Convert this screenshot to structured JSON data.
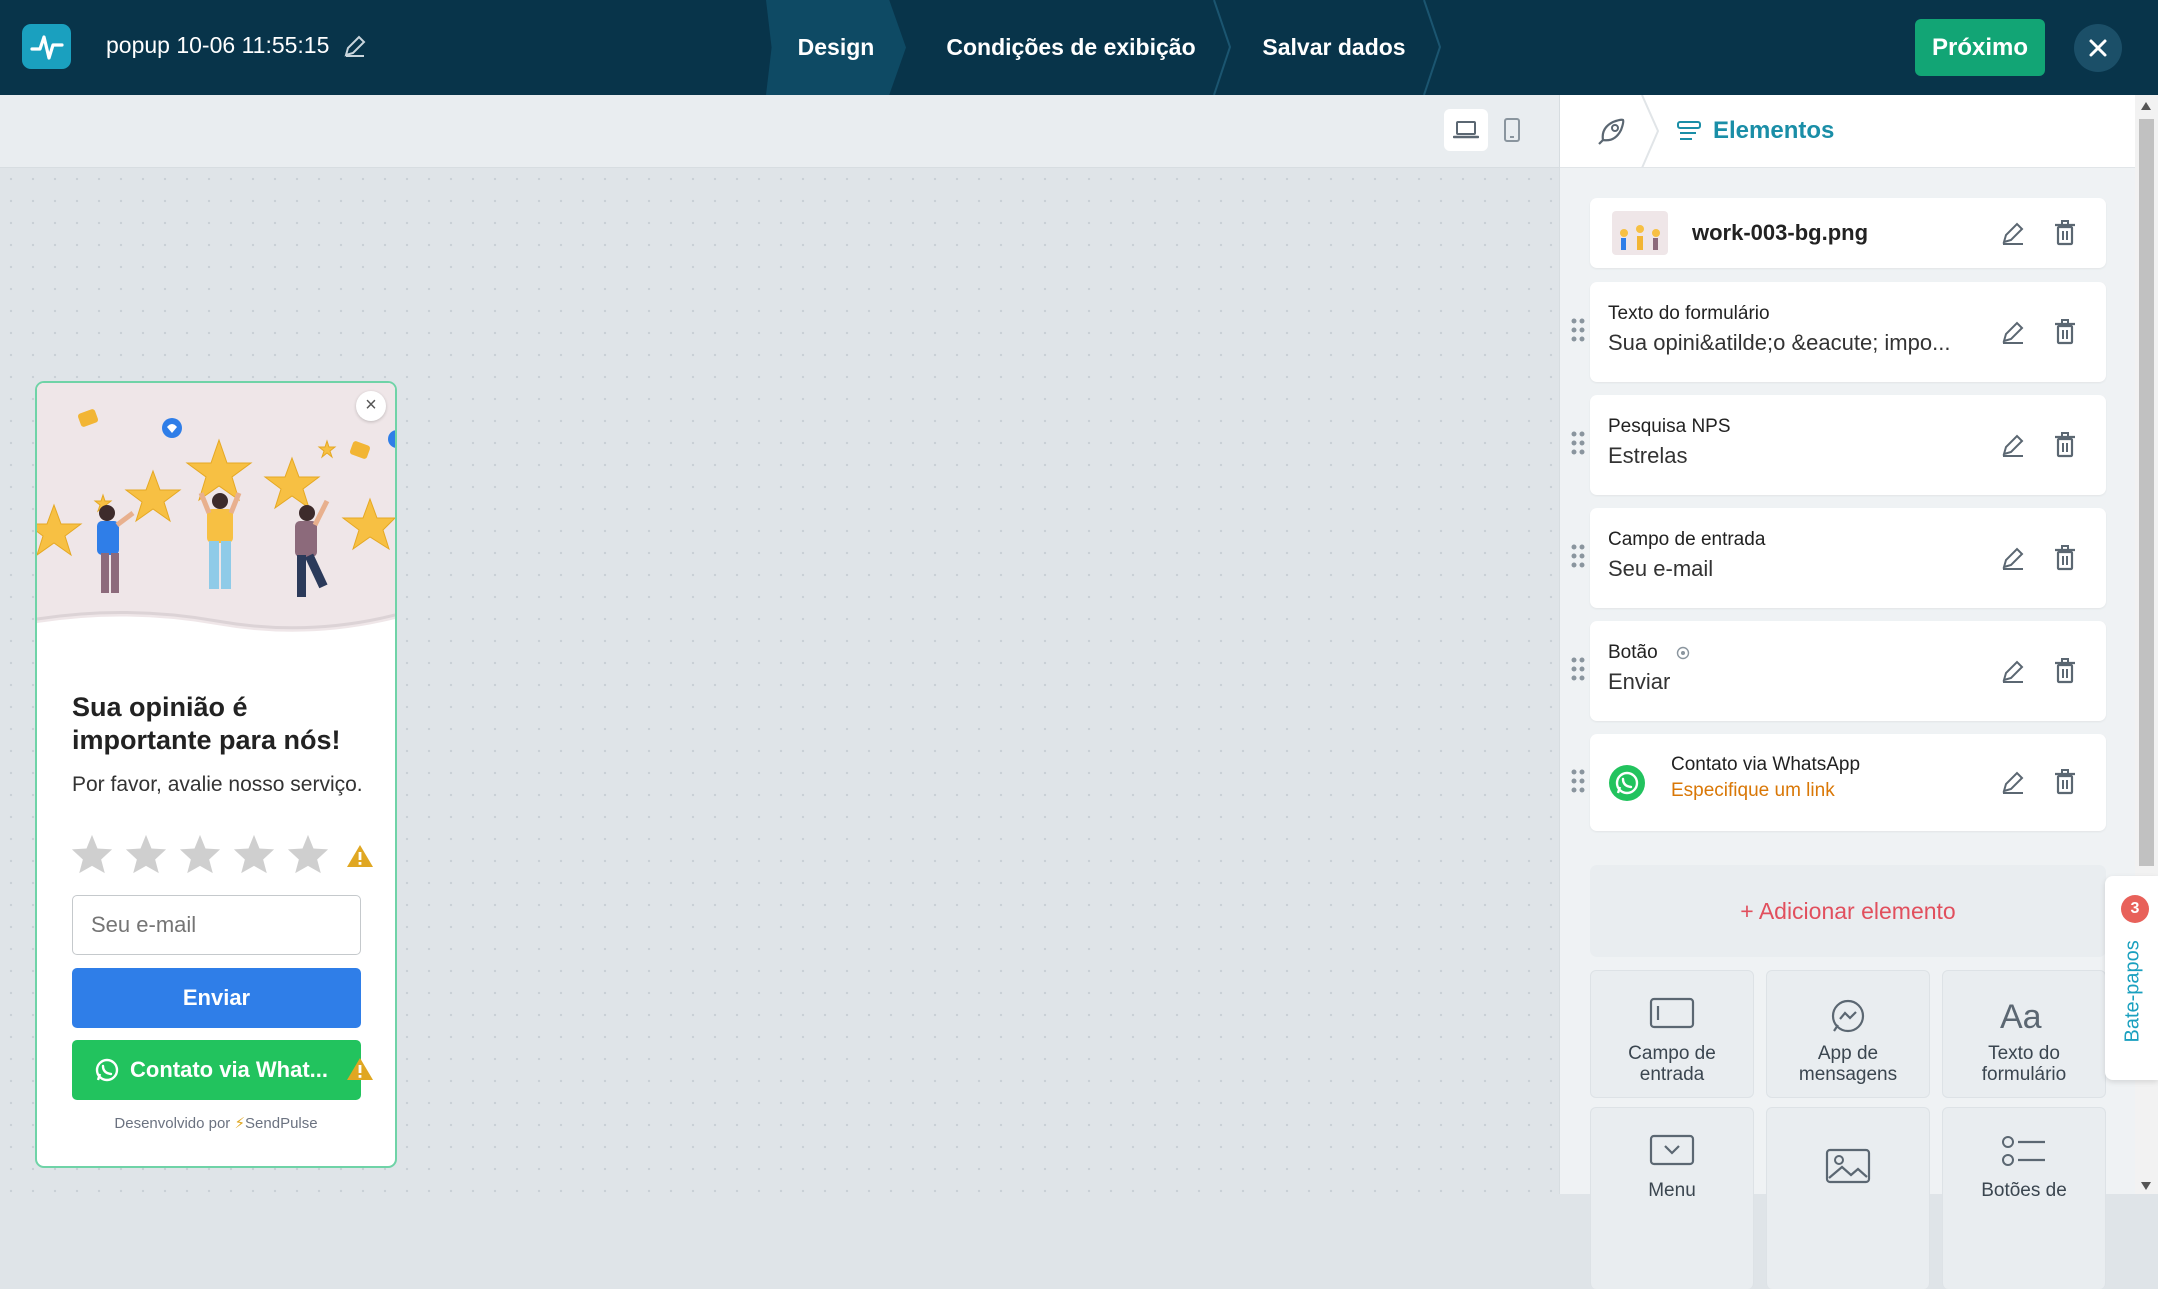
{
  "topbar": {
    "title": "popup 10-06 11:55:15",
    "steps": [
      "Design",
      "Condições de exibição",
      "Salvar dados"
    ],
    "next_label": "Próximo"
  },
  "popup": {
    "heading": "Sua opinião é importante para nós!",
    "subtitle": "Por favor, avalie nosso serviço.",
    "star_count": 5,
    "email_placeholder": "Seu e-mail",
    "send_label": "Enviar",
    "whatsapp_label": "Contato via What...",
    "powered_prefix": "Desenvolvido por",
    "powered_brand": "SendPulse"
  },
  "panel": {
    "title": "Elementos",
    "image_element": "work-003-bg.png",
    "elements": [
      {
        "label": "Texto do formulário",
        "value": "Sua opini&atilde;o &eacute; impo..."
      },
      {
        "label": "Pesquisa NPS",
        "value": "Estrelas"
      },
      {
        "label": "Campo de entrada",
        "value": "Seu e-mail"
      },
      {
        "label": "Botão",
        "value": "Enviar"
      }
    ],
    "whatsapp_element": {
      "label": "Contato via WhatsApp",
      "value": "Especifique um link"
    },
    "add_label": "+ Adicionar elemento",
    "tiles": [
      {
        "line1": "Campo de",
        "line2": "entrada"
      },
      {
        "line1": "App de",
        "line2": "mensagens"
      },
      {
        "line1": "Texto do",
        "line2": "formulário"
      },
      {
        "line1": "Menu",
        "line2": ""
      },
      {
        "line1": "",
        "line2": ""
      },
      {
        "line1": "Botões de",
        "line2": ""
      }
    ]
  },
  "chat": {
    "label": "Bate-papos",
    "count": "3"
  },
  "colors": {
    "topbar": "#08344a",
    "accent": "#1aa0bf",
    "next_button": "#12a575",
    "send_button": "#2f7ee8",
    "whatsapp_button": "#22c35e",
    "add_element": "#e14f5d",
    "warning": "#e0a722"
  }
}
